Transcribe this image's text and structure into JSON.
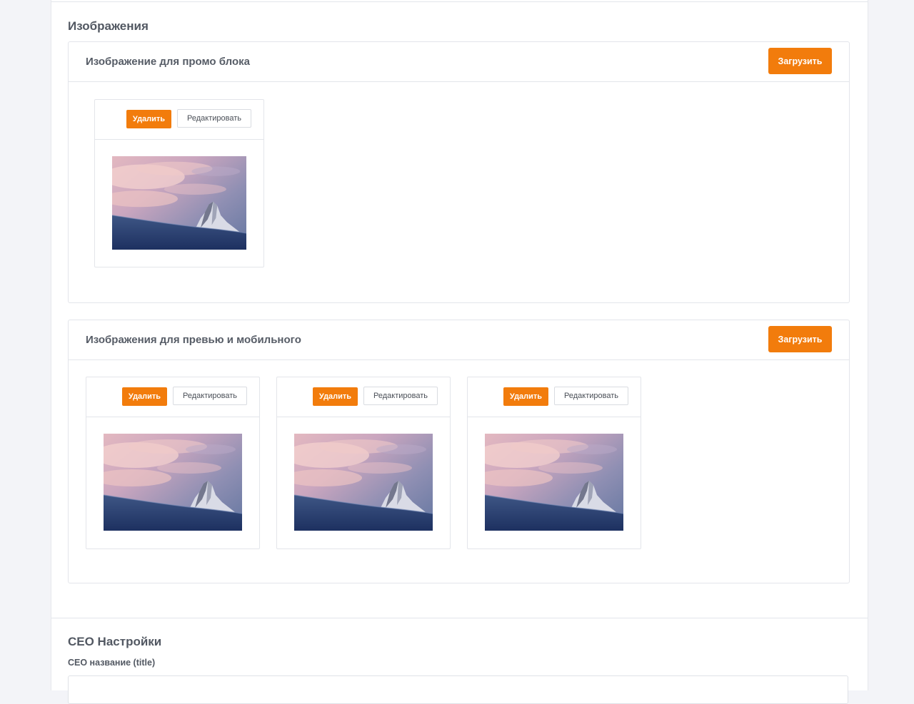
{
  "images_section": {
    "title": "Изображения",
    "promo": {
      "title": "Изображение для промо блока",
      "upload_label": "Загрузить",
      "items": [
        {
          "delete_label": "Удалить",
          "edit_label": "Редактировать",
          "image": "mountain-sunset"
        }
      ]
    },
    "preview": {
      "title": "Изображения для превью и мобильного",
      "upload_label": "Загрузить",
      "items": [
        {
          "delete_label": "Удалить",
          "edit_label": "Редактировать",
          "image": "mountain-sunset"
        },
        {
          "delete_label": "Удалить",
          "edit_label": "Редактировать",
          "image": "mountain-sunset"
        },
        {
          "delete_label": "Удалить",
          "edit_label": "Редактировать",
          "image": "mountain-sunset"
        }
      ]
    }
  },
  "seo_section": {
    "title": "СЕО Настройки",
    "title_field": {
      "label": "СЕО название (title)",
      "value": ""
    }
  },
  "colors": {
    "accent": "#f27c0c",
    "background": "#f3f4f8",
    "border": "#e3e5ea"
  }
}
